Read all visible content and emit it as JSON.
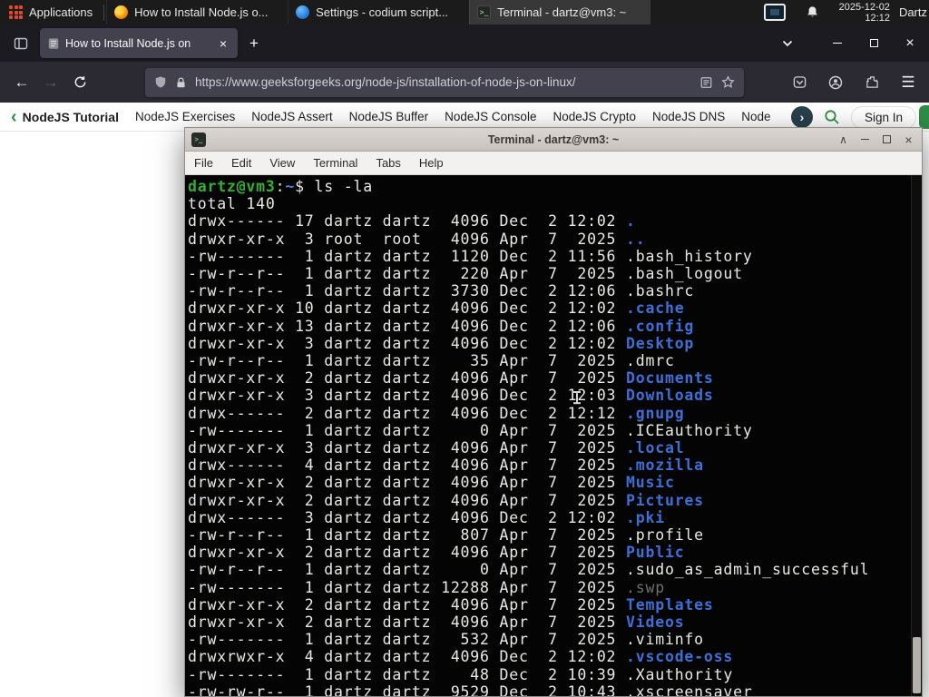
{
  "panel": {
    "applications_label": "Applications",
    "windows": [
      {
        "title": "How to Install Node.js o...",
        "icon": "firefox-icon"
      },
      {
        "title": "Settings - codium script...",
        "icon": "settings-icon"
      },
      {
        "title": "Terminal - dartz@vm3: ~",
        "icon": "terminal-icon"
      }
    ],
    "clock_date": "2025-12-02",
    "clock_time": "12:12",
    "user_label": "Dartz"
  },
  "browser": {
    "tab_title": "How to Install Node.js on",
    "new_tab_label": "+",
    "url": "https://www.geeksforgeeks.org/node-js/installation-of-node-js-on-linux/"
  },
  "gfg": {
    "items": [
      "NodeJS Tutorial",
      "NodeJS Exercises",
      "NodeJS Assert",
      "NodeJS Buffer",
      "NodeJS Console",
      "NodeJS Crypto",
      "NodeJS DNS",
      "Node"
    ],
    "chevron_right": "›",
    "back_chevron": "‹",
    "sign_in_label": "Sign In",
    "accent_green": "#2f8d46"
  },
  "terminal_window": {
    "title": "Terminal - dartz@vm3: ~",
    "menus": [
      "File",
      "Edit",
      "View",
      "Terminal",
      "Tabs",
      "Help"
    ],
    "colors": {
      "prompt_green": "#33b033",
      "dir_blue": "#3d6fd6",
      "dim_gray": "#6f6f6f",
      "background": "#040404"
    }
  },
  "terminal": {
    "lines": [
      {
        "prompt": true,
        "user": "dartz@vm3",
        "colon": ":",
        "path": "~",
        "dollar": "$ ",
        "cmd": "ls -la"
      },
      {
        "p": "total 140"
      },
      {
        "p": "drwx------ 17 dartz dartz  4096 Dec  2 12:02 ",
        "n": ".",
        "c": "dir"
      },
      {
        "p": "drwxr-xr-x  3 root  root   4096 Apr  7  2025 ",
        "n": "..",
        "c": "dir"
      },
      {
        "p": "-rw-------  1 dartz dartz  1120 Dec  2 11:56 ",
        "n": ".bash_history"
      },
      {
        "p": "-rw-r--r--  1 dartz dartz   220 Apr  7  2025 ",
        "n": ".bash_logout"
      },
      {
        "p": "-rw-r--r--  1 dartz dartz  3730 Dec  2 12:06 ",
        "n": ".bashrc"
      },
      {
        "p": "drwxr-xr-x 10 dartz dartz  4096 Dec  2 12:02 ",
        "n": ".cache",
        "c": "dir"
      },
      {
        "p": "drwxr-xr-x 13 dartz dartz  4096 Dec  2 12:06 ",
        "n": ".config",
        "c": "dir"
      },
      {
        "p": "drwxr-xr-x  3 dartz dartz  4096 Dec  2 12:02 ",
        "n": "Desktop",
        "c": "dir"
      },
      {
        "p": "-rw-r--r--  1 dartz dartz    35 Apr  7  2025 ",
        "n": ".dmrc"
      },
      {
        "p": "drwxr-xr-x  2 dartz dartz  4096 Apr  7  2025 ",
        "n": "Documents",
        "c": "dir"
      },
      {
        "p": "drwxr-xr-x  3 dartz dartz  4096 Dec  2 12:03 ",
        "n": "Downloads",
        "c": "dir"
      },
      {
        "p": "drwx------  2 dartz dartz  4096 Dec  2 12:12 ",
        "n": ".gnupg",
        "c": "dir"
      },
      {
        "p": "-rw-------  1 dartz dartz     0 Apr  7  2025 ",
        "n": ".ICEauthority"
      },
      {
        "p": "drwxr-xr-x  3 dartz dartz  4096 Apr  7  2025 ",
        "n": ".local",
        "c": "dir"
      },
      {
        "p": "drwx------  4 dartz dartz  4096 Apr  7  2025 ",
        "n": ".mozilla",
        "c": "dir"
      },
      {
        "p": "drwxr-xr-x  2 dartz dartz  4096 Apr  7  2025 ",
        "n": "Music",
        "c": "dir"
      },
      {
        "p": "drwxr-xr-x  2 dartz dartz  4096 Apr  7  2025 ",
        "n": "Pictures",
        "c": "dir"
      },
      {
        "p": "drwx------  3 dartz dartz  4096 Dec  2 12:02 ",
        "n": ".pki",
        "c": "dir"
      },
      {
        "p": "-rw-r--r--  1 dartz dartz   807 Apr  7  2025 ",
        "n": ".profile"
      },
      {
        "p": "drwxr-xr-x  2 dartz dartz  4096 Apr  7  2025 ",
        "n": "Public",
        "c": "dir"
      },
      {
        "p": "-rw-r--r--  1 dartz dartz     0 Apr  7  2025 ",
        "n": ".sudo_as_admin_successful"
      },
      {
        "p": "-rw-------  1 dartz dartz 12288 Apr  7  2025 ",
        "n": ".swp",
        "c": "dim"
      },
      {
        "p": "drwxr-xr-x  2 dartz dartz  4096 Apr  7  2025 ",
        "n": "Templates",
        "c": "dir"
      },
      {
        "p": "drwxr-xr-x  2 dartz dartz  4096 Apr  7  2025 ",
        "n": "Videos",
        "c": "dir"
      },
      {
        "p": "-rw-------  1 dartz dartz   532 Apr  7  2025 ",
        "n": ".viminfo"
      },
      {
        "p": "drwxrwxr-x  4 dartz dartz  4096 Dec  2 12:02 ",
        "n": ".vscode-oss",
        "c": "dir"
      },
      {
        "p": "-rw-------  1 dartz dartz    48 Dec  2 10:39 ",
        "n": ".Xauthority"
      },
      {
        "p": "-rw-rw-r--  1 dartz dartz  9529 Dec  2 10:43 ",
        "n": ".xscreensaver"
      }
    ]
  }
}
